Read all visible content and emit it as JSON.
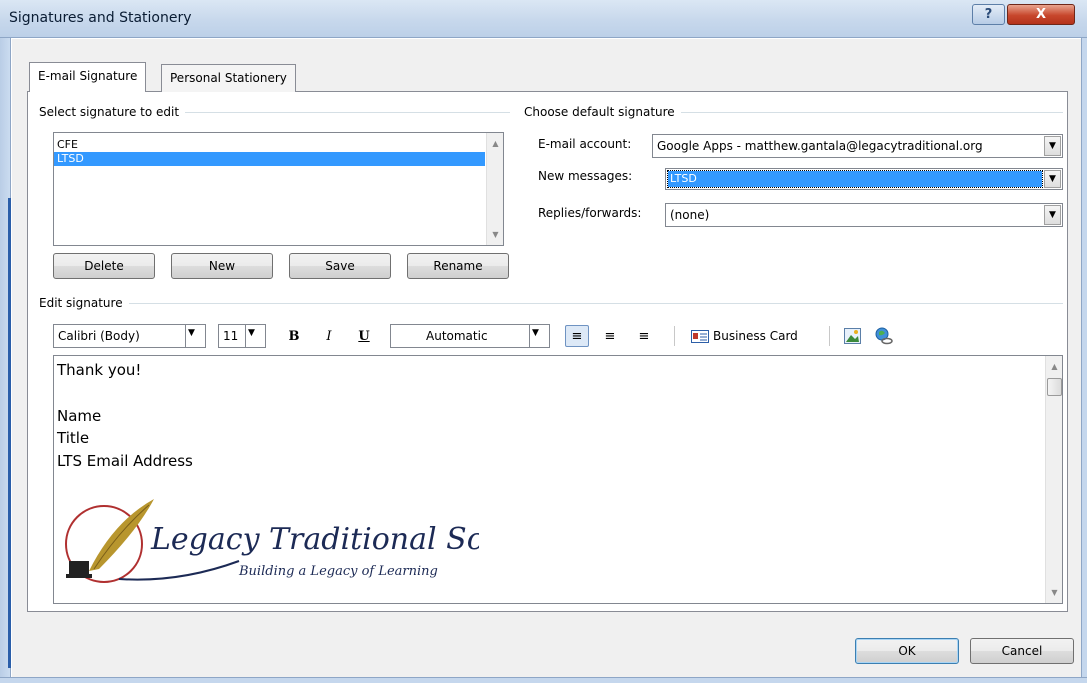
{
  "window": {
    "title": "Signatures and Stationery",
    "help_label": "?",
    "close_label": "X"
  },
  "tabs": [
    {
      "label": "E-mail Signature",
      "active": true
    },
    {
      "label": "Personal Stationery",
      "active": false
    }
  ],
  "select_group": {
    "label": "Select signature to edit",
    "items": [
      {
        "label": "CFE",
        "selected": false
      },
      {
        "label": "LTSD",
        "selected": true
      }
    ],
    "buttons": {
      "delete": "Delete",
      "new": "New",
      "save": "Save",
      "rename": "Rename"
    }
  },
  "default_group": {
    "label": "Choose default signature",
    "email_account_label": "E-mail account:",
    "email_account_value": "Google Apps - matthew.gantala@legacytraditional.org",
    "new_messages_label": "New messages:",
    "new_messages_value": "LTSD",
    "replies_label": "Replies/forwards:",
    "replies_value": "(none)"
  },
  "edit_group": {
    "label": "Edit signature",
    "font_value": "Calibri (Body)",
    "size_value": "11",
    "bold": "B",
    "italic": "I",
    "underline": "U",
    "color_value": "Automatic",
    "business_card_label": "Business Card",
    "body_lines": [
      "Thank you!",
      "",
      "Name",
      "Title",
      "LTS Email Address"
    ],
    "logo": {
      "name": "Legacy Traditional School",
      "tagline": "Building a Legacy of Learning"
    }
  },
  "footer": {
    "ok": "OK",
    "cancel": "Cancel"
  },
  "colors": {
    "selection": "#3399ff",
    "close": "#c7472c",
    "logo_navy": "#1c2a55",
    "logo_gold": "#b8962e",
    "logo_red": "#b03030"
  }
}
